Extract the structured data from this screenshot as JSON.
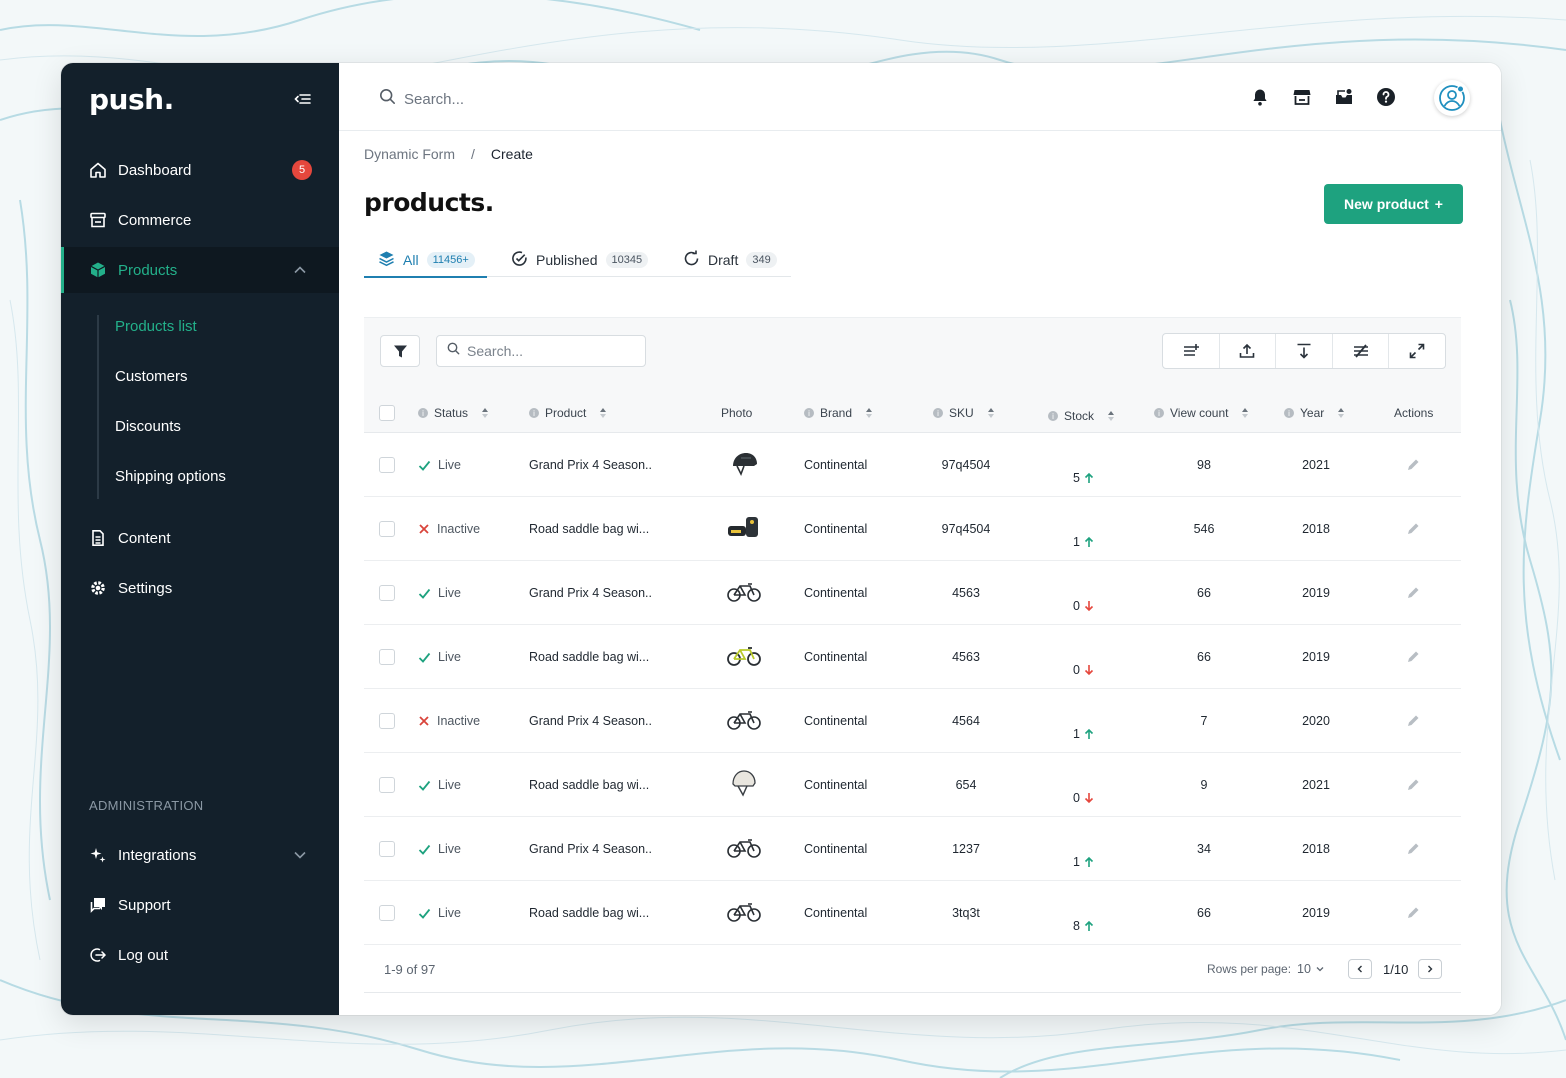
{
  "colors": {
    "sidebar_bg": "#13202b",
    "accent": "#1ea27f",
    "badge_red": "#e5473d",
    "tab_active": "#1f7fb0"
  },
  "sidebar": {
    "logo": "push.",
    "items": [
      {
        "label": "Dashboard",
        "icon": "home-icon",
        "badge": "5"
      },
      {
        "label": "Commerce",
        "icon": "store-icon"
      },
      {
        "label": "Products",
        "icon": "box-icon",
        "active": true
      },
      {
        "label": "Content",
        "icon": "document-icon"
      },
      {
        "label": "Settings",
        "icon": "gear-icon"
      }
    ],
    "sub_items": [
      {
        "label": "Products list",
        "active": true
      },
      {
        "label": "Customers"
      },
      {
        "label": "Discounts"
      },
      {
        "label": "Shipping options"
      }
    ],
    "admin_label": "ADMINISTRATION",
    "admin_items": [
      {
        "label": "Integrations",
        "icon": "sparkle-icon"
      },
      {
        "label": "Support",
        "icon": "chat-icon"
      },
      {
        "label": "Log out",
        "icon": "logout-icon"
      }
    ]
  },
  "topbar": {
    "search_placeholder": "Search..."
  },
  "breadcrumb": {
    "parent": "Dynamic Form",
    "separator": "/",
    "current": "Create"
  },
  "page": {
    "title": "products.",
    "new_button": "New product",
    "new_button_icon": "+"
  },
  "tabs": [
    {
      "label": "All",
      "count": "11456+",
      "icon": "layers-icon",
      "active": true
    },
    {
      "label": "Published",
      "count": "10345",
      "icon": "check-circle-icon"
    },
    {
      "label": "Draft",
      "count": "349",
      "icon": "refresh-icon"
    }
  ],
  "table": {
    "search_placeholder": "Search...",
    "columns": {
      "status": "Status",
      "product": "Product",
      "photo": "Photo",
      "brand": "Brand",
      "sku": "SKU",
      "stock": "Stock",
      "view_count": "View count",
      "year": "Year",
      "actions": "Actions"
    },
    "rows": [
      {
        "status": "Live",
        "live": true,
        "product": "Grand Prix 4 Season..",
        "photo": "helmet-dark",
        "brand": "Continental",
        "sku": "97q4504",
        "stock": "5",
        "trend": "up",
        "views": "98",
        "year": "2021"
      },
      {
        "status": "Inactive",
        "live": false,
        "product": "Road saddle bag wi...",
        "photo": "bag",
        "brand": "Continental",
        "sku": "97q4504",
        "stock": "1",
        "trend": "up",
        "views": "546",
        "year": "2018"
      },
      {
        "status": "Live",
        "live": true,
        "product": "Grand Prix 4 Season..",
        "photo": "bike",
        "brand": "Continental",
        "sku": "4563",
        "stock": "0",
        "trend": "down",
        "views": "66",
        "year": "2019"
      },
      {
        "status": "Live",
        "live": true,
        "product": "Road saddle bag wi...",
        "photo": "bike-yellow",
        "brand": "Continental",
        "sku": "4563",
        "stock": "0",
        "trend": "down",
        "views": "66",
        "year": "2019"
      },
      {
        "status": "Inactive",
        "live": false,
        "product": "Grand Prix 4 Season..",
        "photo": "bike",
        "brand": "Continental",
        "sku": "4564",
        "stock": "1",
        "trend": "up",
        "views": "7",
        "year": "2020"
      },
      {
        "status": "Live",
        "live": true,
        "product": "Road saddle bag wi...",
        "photo": "helmet-white",
        "brand": "Continental",
        "sku": "654",
        "stock": "0",
        "trend": "down",
        "views": "9",
        "year": "2021"
      },
      {
        "status": "Live",
        "live": true,
        "product": "Grand Prix 4 Season..",
        "photo": "bike",
        "brand": "Continental",
        "sku": "1237",
        "stock": "1",
        "trend": "up",
        "views": "34",
        "year": "2018"
      },
      {
        "status": "Live",
        "live": true,
        "product": "Road saddle bag wi...",
        "photo": "bike",
        "brand": "Continental",
        "sku": "3tq3t",
        "stock": "8",
        "trend": "up",
        "views": "66",
        "year": "2019"
      }
    ],
    "footer": {
      "range": "1-9 of 97",
      "rows_per_page_label": "Rows per page:",
      "rows_per_page": "10",
      "page": "1/10"
    }
  }
}
